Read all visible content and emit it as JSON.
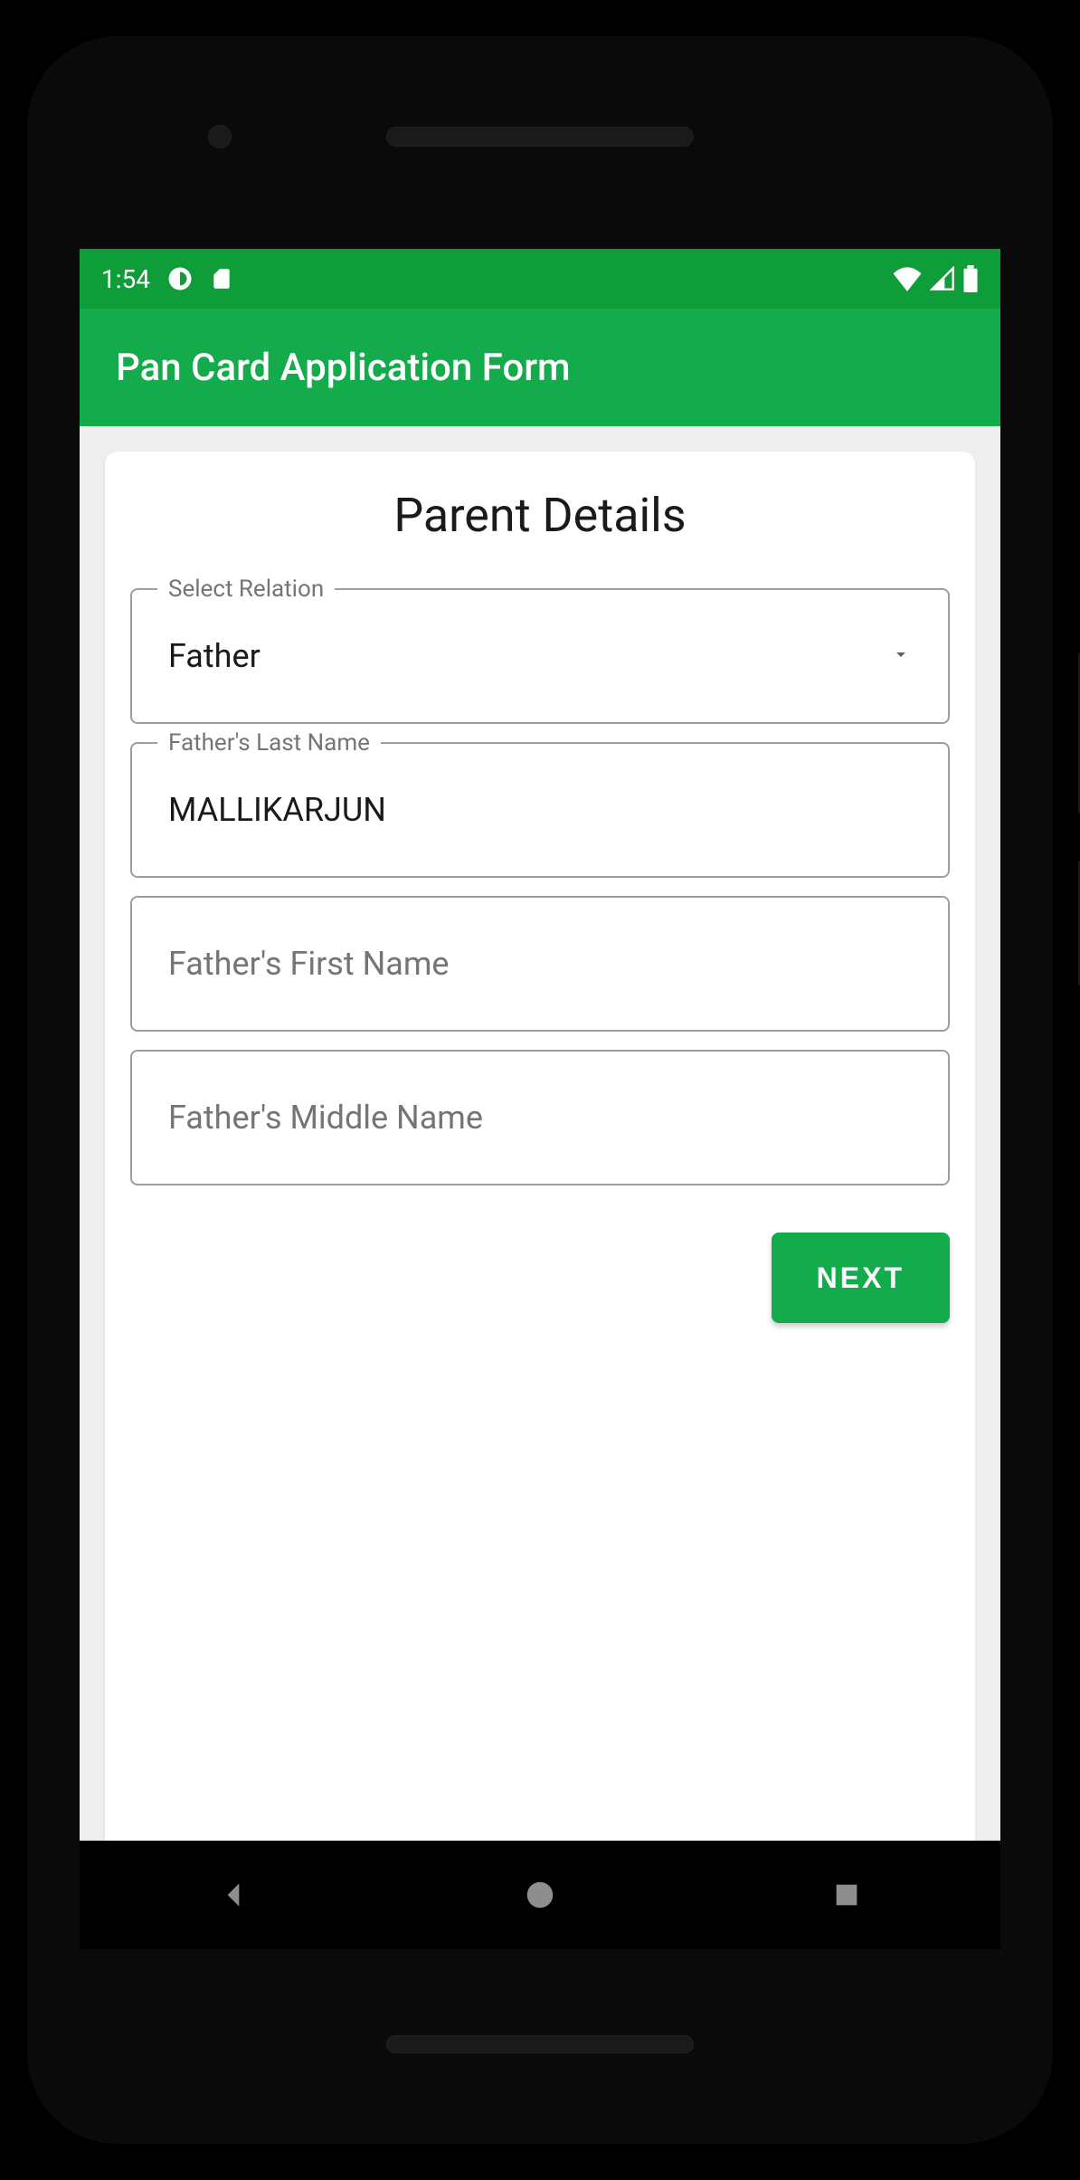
{
  "status": {
    "time": "1:54"
  },
  "app": {
    "title": "Pan Card Application Form"
  },
  "section": {
    "title": "Parent Details"
  },
  "form": {
    "relation": {
      "label": "Select Relation",
      "value": "Father"
    },
    "lastName": {
      "label": "Father's Last Name",
      "value": "MALLIKARJUN"
    },
    "firstName": {
      "placeholder": "Father's First Name",
      "value": ""
    },
    "middleName": {
      "placeholder": "Father's Middle Name",
      "value": ""
    }
  },
  "actions": {
    "next": "NEXT"
  }
}
